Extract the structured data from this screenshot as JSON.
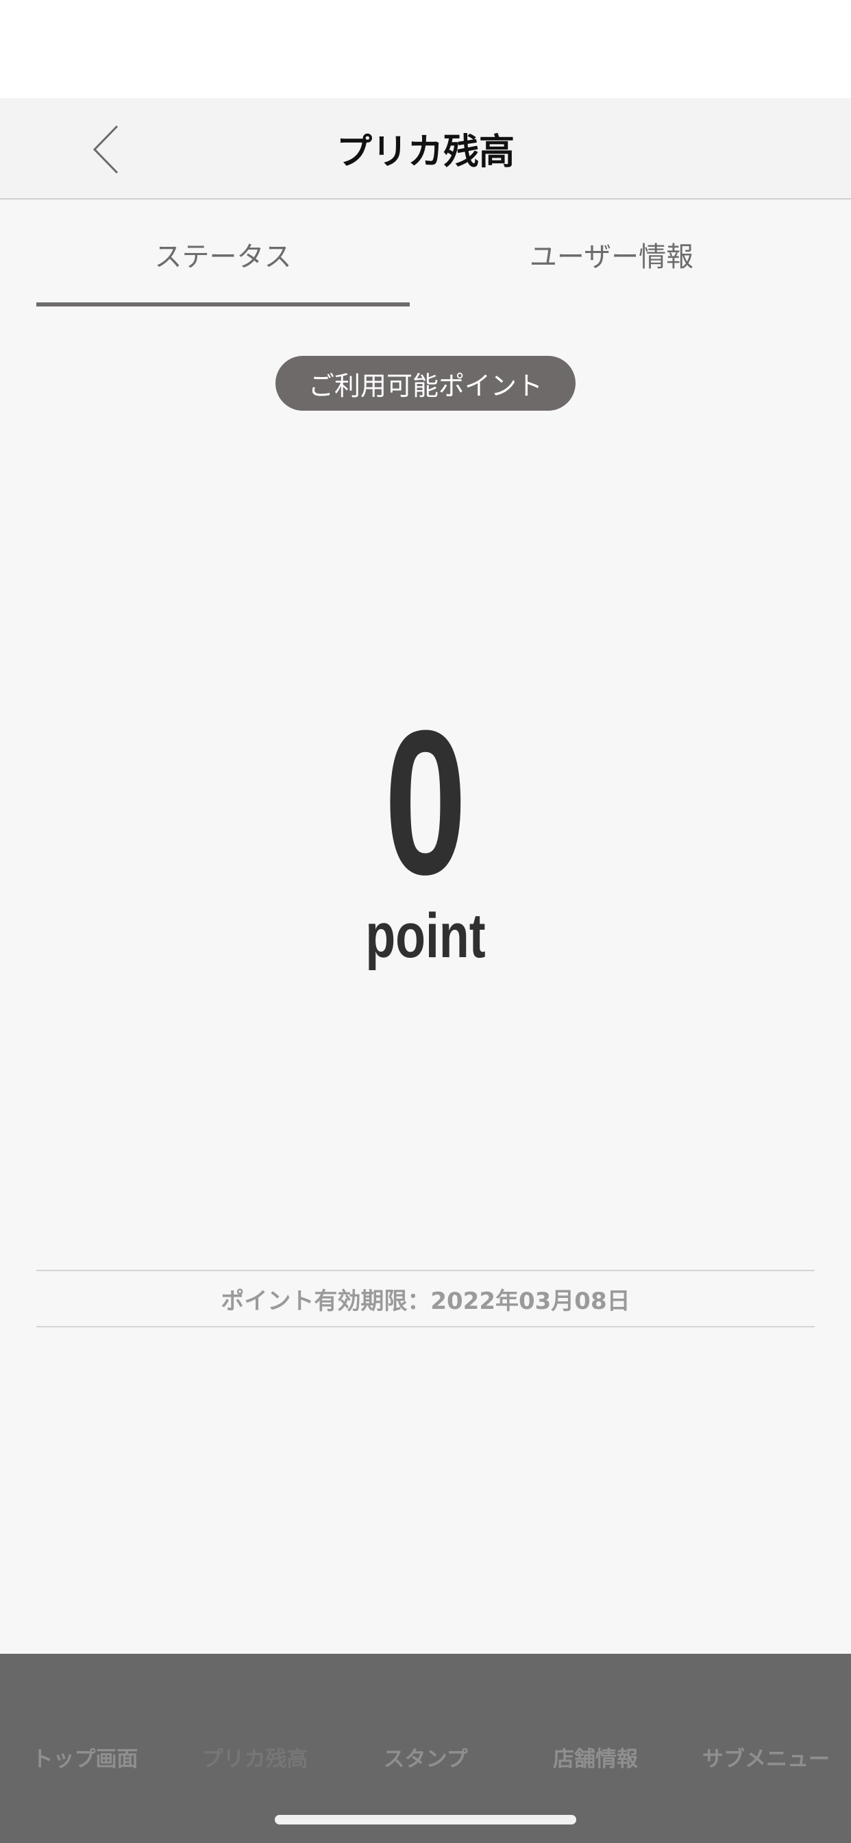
{
  "header": {
    "title": "プリカ残高"
  },
  "tabs": [
    {
      "label": "ステータス",
      "selected": true
    },
    {
      "label": "ユーザー情報",
      "selected": false
    }
  ],
  "points": {
    "badge": "ご利用可能ポイント",
    "value": "0",
    "unit": "point",
    "expiry": "ポイント有効期限：2022年03月08日"
  },
  "bottom_nav": {
    "items": [
      {
        "label": "トップ画面",
        "active": false
      },
      {
        "label": "プリカ残高",
        "active": true
      },
      {
        "label": "スタンプ",
        "active": false
      },
      {
        "label": "店舗情報",
        "active": false
      },
      {
        "label": "サブメニュー",
        "active": false
      }
    ]
  },
  "icons": {
    "back": "chevron-left-icon"
  },
  "colors": {
    "accent": "#6f6b6b",
    "text_dark": "#303030",
    "tab_bar": "#686868"
  }
}
